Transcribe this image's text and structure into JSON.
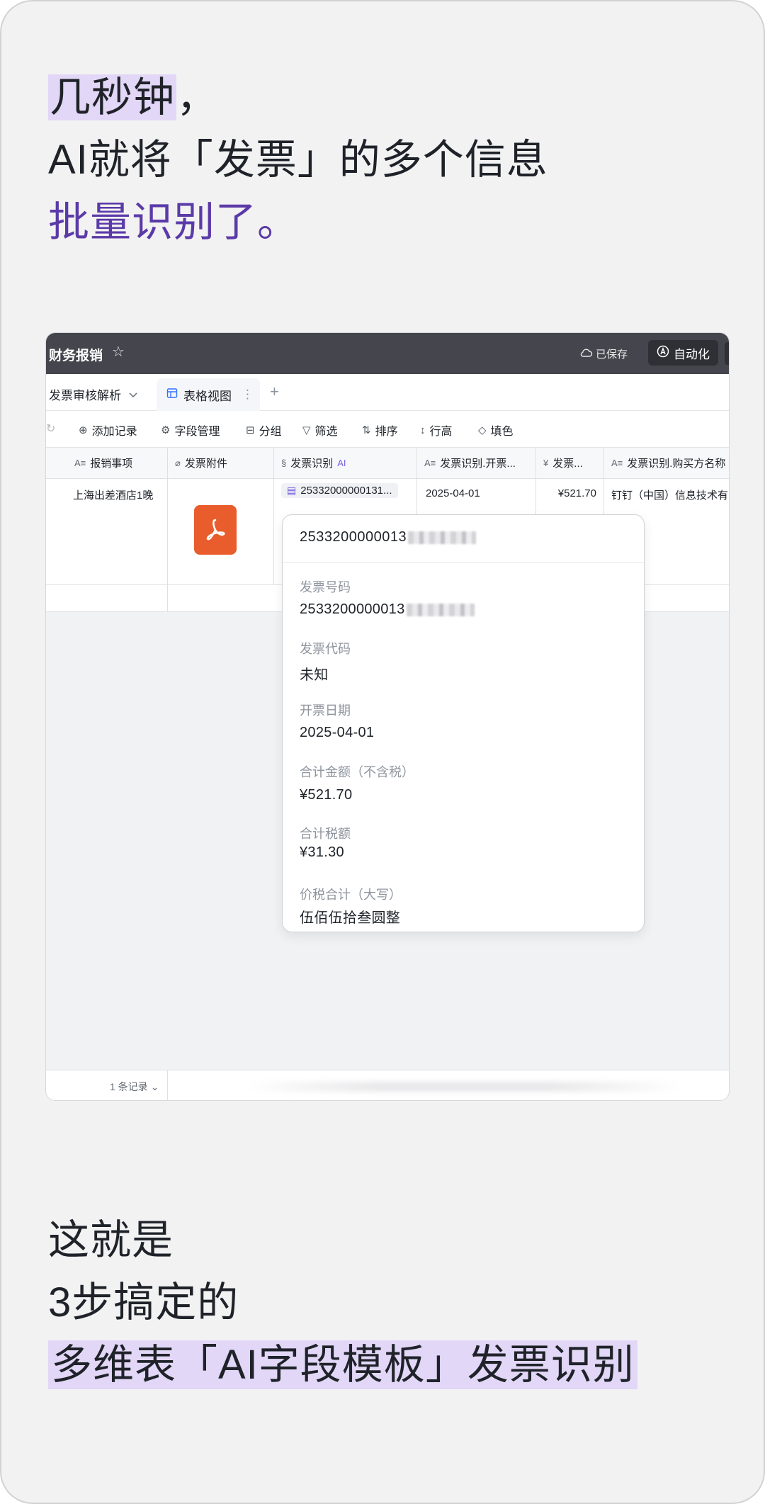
{
  "headline": {
    "line1": "几秒钟",
    "line1_punct": "，",
    "line2": "AI就将「发票」的多个信息",
    "line3": "批量识别了。"
  },
  "app": {
    "title": "财务报销",
    "saved_label": "已保存",
    "automation_label": "自动化",
    "view_dropdown": "发票审核解析",
    "view_tab": "表格视图",
    "toolbar": {
      "add_record": "添加记录",
      "field_manage": "字段管理",
      "group": "分组",
      "filter": "筛选",
      "sort": "排序",
      "row_height": "行高",
      "fill_color": "填色"
    },
    "columns": [
      "报销事项",
      "发票附件",
      "发票识别",
      "发票识别.开票...",
      "发票...",
      "发票识别.购买方名称"
    ],
    "ai_tag": "AI",
    "row": {
      "item": "上海出差酒店1晚",
      "invoice_id": "25332000000131...",
      "date": "2025-04-01",
      "amount": "¥521.70",
      "buyer": "钉钉（中国）信息技术有"
    },
    "popup": {
      "title": "2533200000013",
      "fields": [
        {
          "label": "发票号码",
          "value": "2533200000013"
        },
        {
          "label": "发票代码",
          "value": "未知"
        },
        {
          "label": "开票日期",
          "value": "2025-04-01"
        },
        {
          "label": "合计金额（不含税）",
          "value": "¥521.70"
        },
        {
          "label": "合计税额",
          "value": "¥31.30"
        },
        {
          "label": "价税合计（大写）",
          "value": "伍佰伍拾叁圆整"
        }
      ]
    },
    "record_count": "1 条记录"
  },
  "footer": {
    "line1": "这就是",
    "line2": "3步搞定的",
    "line3": "多维表「AI字段模板」发票识别"
  },
  "colors": {
    "highlight": "#e2d7f7",
    "purple_text": "#5b3aa8",
    "topbar": "#45464d",
    "pdf": "#e85d2b"
  }
}
